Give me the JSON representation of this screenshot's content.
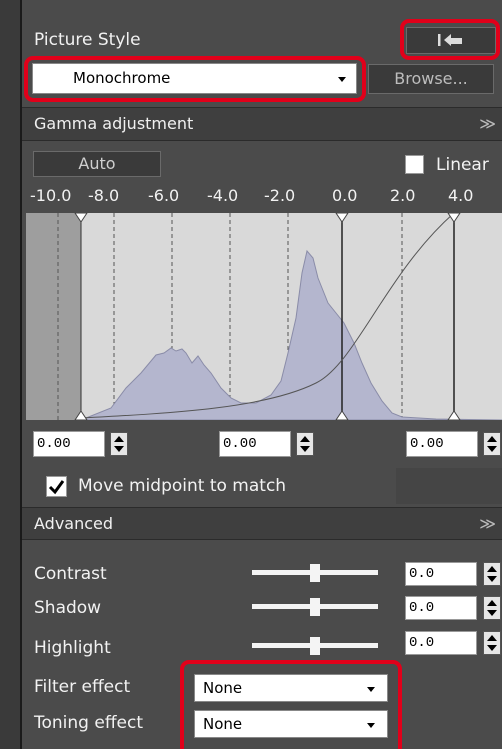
{
  "picture_style": {
    "title": "Picture Style",
    "style_value": "Monochrome",
    "browse_label": "Browse..."
  },
  "gamma": {
    "section_title": "Gamma adjustment",
    "auto_label": "Auto",
    "linear_label": "Linear",
    "linear_checked": false,
    "scale_labels": [
      "-10.0",
      "-8.0",
      "-6.0",
      "-4.0",
      "-2.0",
      "0.0",
      "2.0",
      "4.0"
    ],
    "fields": {
      "left": "0.00",
      "mid": "0.00",
      "right": "0.00"
    },
    "midpoint_label": "Move midpoint to match",
    "midpoint_checked": true
  },
  "advanced": {
    "section_title": "Advanced",
    "contrast_label": "Contrast",
    "contrast_value": "0.0",
    "shadow_label": "Shadow",
    "shadow_value": "0.0",
    "highlight_label": "Highlight",
    "highlight_value": "0.0",
    "filter_label": "Filter effect",
    "filter_value": "None",
    "toning_label": "Toning effect",
    "toning_value": "None"
  },
  "colors": {
    "panel_bg": "#4b4b4b",
    "highlight_red": "#e1001a",
    "histogram_fill": "#b4b6ce"
  }
}
